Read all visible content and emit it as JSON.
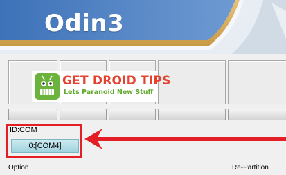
{
  "app": {
    "title": "Odin3"
  },
  "watermark": {
    "title": "GET DROID TIPS",
    "subtitle": "Lets Paranoid New Stuff",
    "icon": "android-robot-icon"
  },
  "device_slots": [
    {
      "id": "slot-1"
    },
    {
      "id": "slot-2"
    },
    {
      "id": "slot-3"
    },
    {
      "id": "slot-4"
    },
    {
      "id": "slot-5"
    }
  ],
  "connection": {
    "label": "ID:COM",
    "port_value": "0:[COM4]"
  },
  "sections": {
    "option": "Option",
    "repartition": "Re-Partition"
  },
  "annotation": {
    "color": "#e31e24",
    "arrow_direction": "left"
  },
  "colors": {
    "header_blue": "#2f5c9c",
    "header_gold": "#d9b86a",
    "port_field": "#aedde6"
  }
}
